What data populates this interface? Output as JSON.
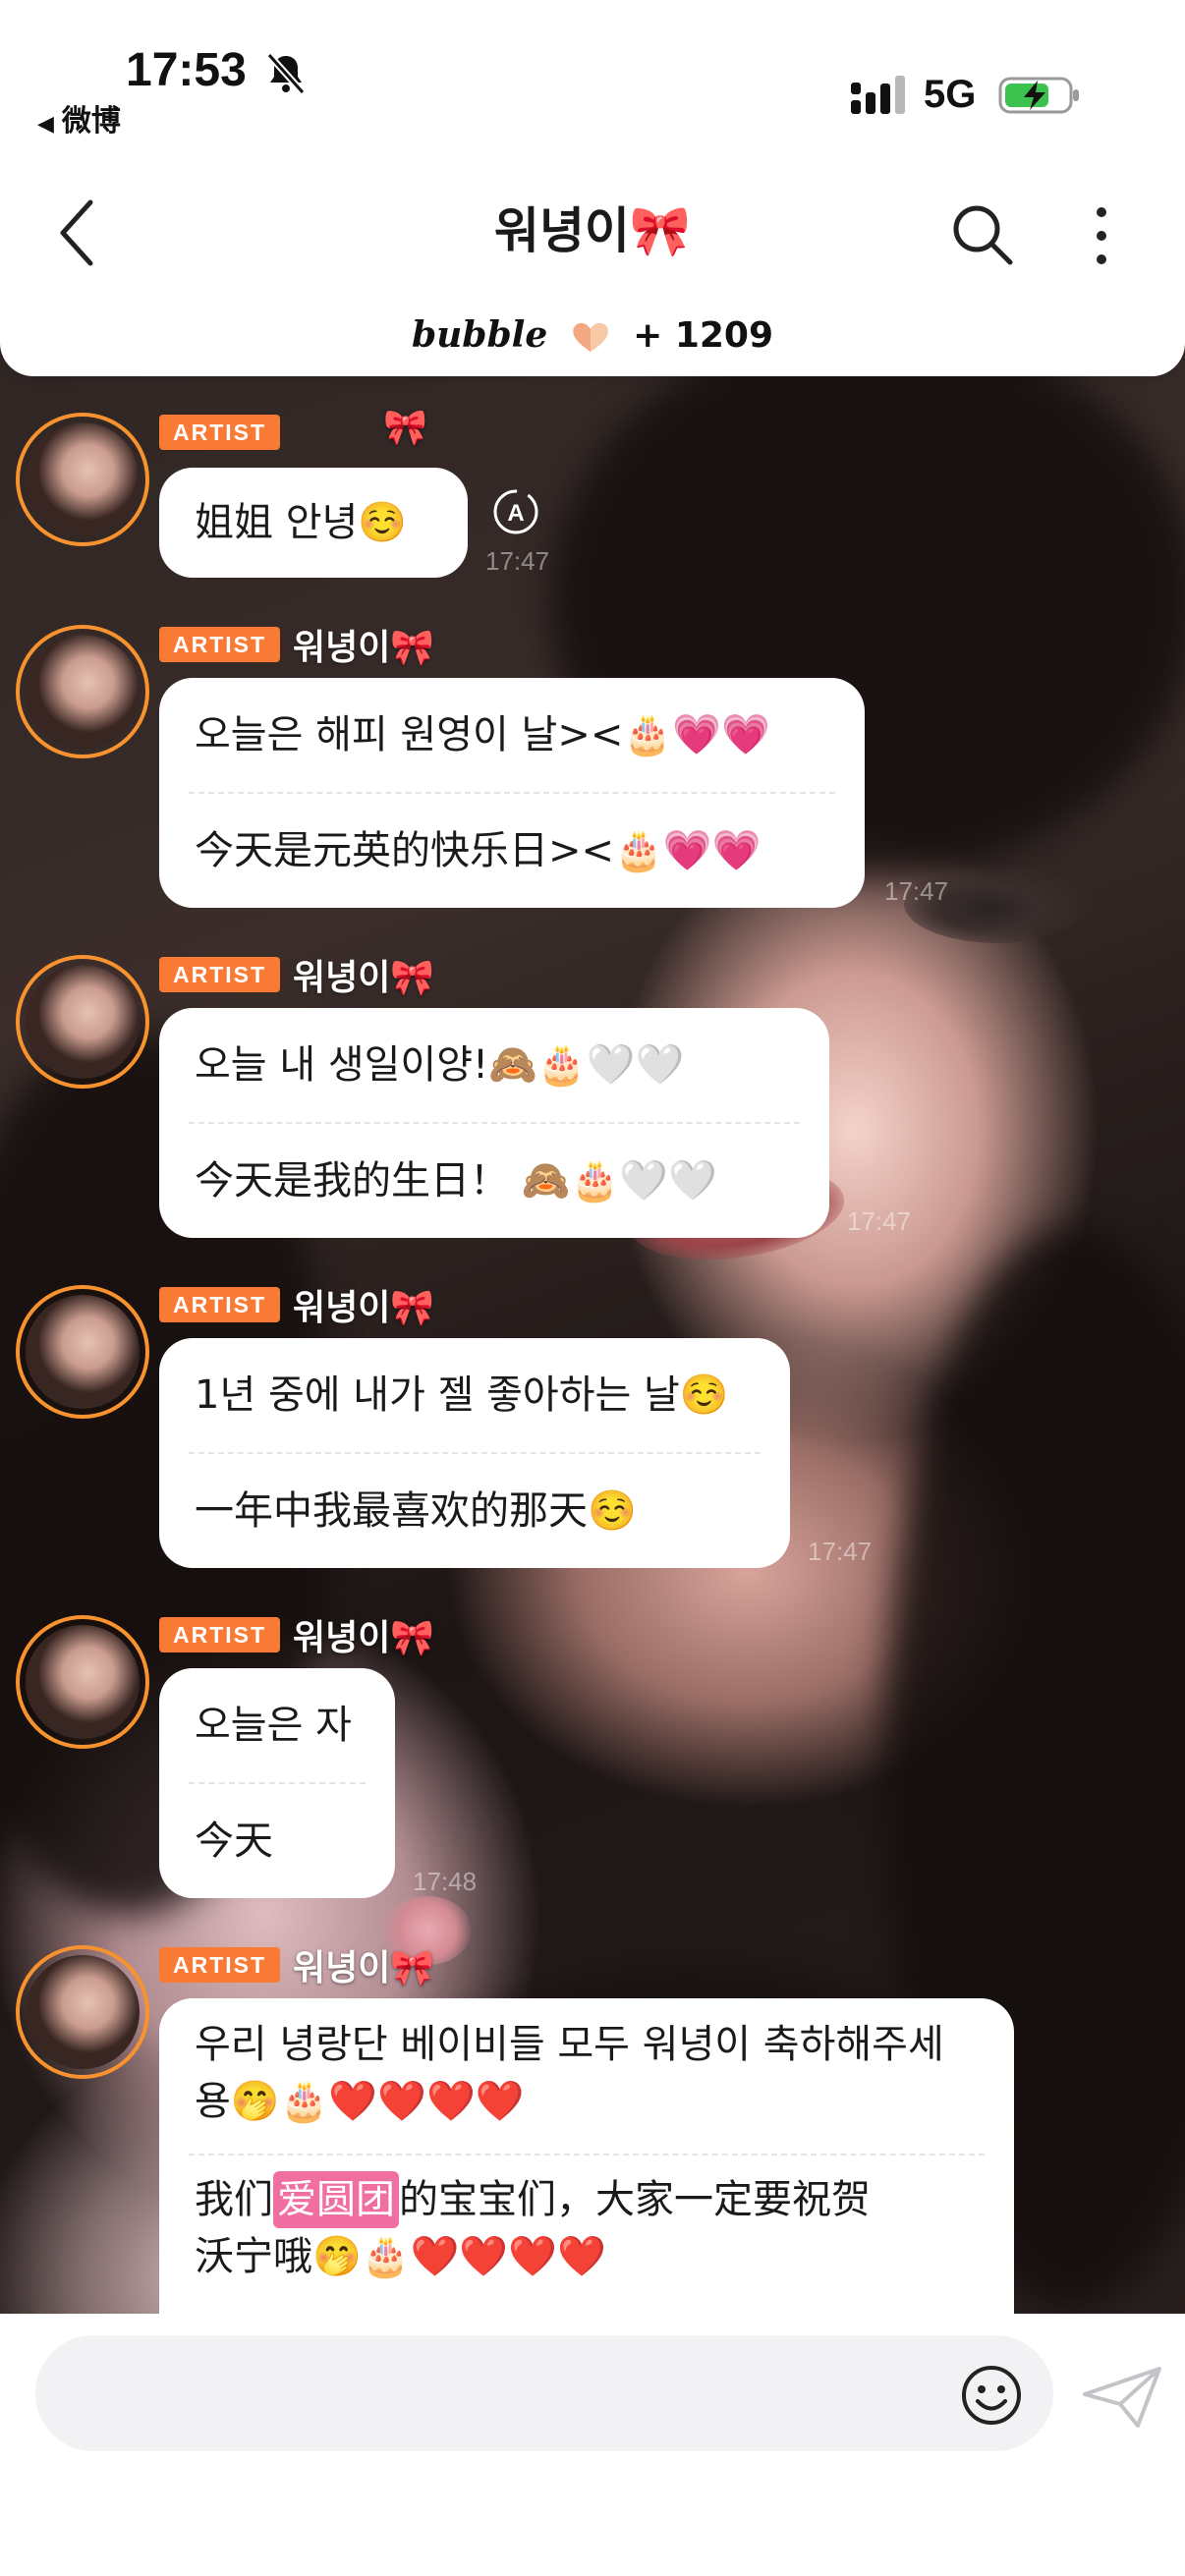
{
  "status_bar": {
    "time": "17:53",
    "back_app": "微博",
    "network": "5G",
    "icons": [
      "bell-muted-icon",
      "signal-icon",
      "battery-charging-icon"
    ]
  },
  "header": {
    "title": "워녕이🎀",
    "brand": "bubble",
    "brand_count": "+ 1209",
    "icons": [
      "back-arrow-icon",
      "search-icon",
      "more-vertical-icon",
      "heart-emblem-icon"
    ]
  },
  "badge_label": "ARTIST",
  "colors": {
    "accent_orange": "#f97a34",
    "avatar_ring": "#f7922e",
    "highlight_pink": "#f06fa0"
  },
  "messages": [
    {
      "sender": "🎀",
      "lines": [
        "姐姐 안녕☺️"
      ],
      "time": "17:47"
    },
    {
      "sender": "워녕이🎀",
      "lines": [
        "오늘은 해피 원영이 날><🎂💗💗",
        "今天是元英的快乐日><🎂💗💗"
      ],
      "time": "17:47"
    },
    {
      "sender": "워녕이🎀",
      "lines": [
        "오늘 내 생일이양!🙈🎂🤍🤍",
        "今天是我的生日！ 🙈🎂🤍🤍"
      ],
      "time": "17:47"
    },
    {
      "sender": "워녕이🎀",
      "lines": [
        "1년 중에 내가 젤 좋아하는 날☺️",
        "一年中我最喜欢的那天☺️"
      ],
      "time": "17:47"
    },
    {
      "sender": "워녕이🎀",
      "lines": [
        "오늘은 자",
        "今天"
      ],
      "time": "17:48"
    },
    {
      "sender": "워녕이🎀",
      "lines": [
        "우리 녕랑단 베이비들 모두 워녕이 축하해주세",
        "용🤭🎂❤️❤️❤️❤️"
      ],
      "translation_prefix": "我们",
      "translation_highlight": "爱圆团",
      "translation_rest": "的宝宝们，大家一定要祝贺",
      "translation_line2": "沃宁哦🤭🎂❤️❤️❤️❤️"
    }
  ],
  "composer": {
    "placeholder": "",
    "icons": [
      "emoji-icon",
      "send-icon"
    ]
  }
}
